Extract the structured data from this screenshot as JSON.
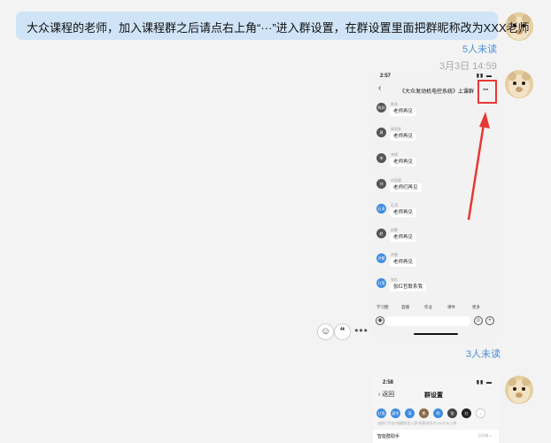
{
  "chat": {
    "message_text": "大众课程的老师，加入课程群之后请点右上角“···”进入群设置，在群设置里面把群昵称改为XXX老师",
    "message_read_status": "5人未读",
    "timestamp": "3月3日 14:59",
    "image_read_status": "3人未读"
  },
  "phone_screenshot": {
    "status_time": "2:57",
    "nav_title": "《大众发动机电控系统》上课群",
    "more_glyph": "···",
    "messages": [
      {
        "name": "陈润",
        "text": "老师再见",
        "avatar": "陈润"
      },
      {
        "name": "周润发",
        "text": "老师再见",
        "avatar": "周"
      },
      {
        "name": "李明",
        "text": "老师再见",
        "avatar": "李"
      },
      {
        "name": "刘思颖",
        "text": "老师们再见",
        "avatar": "刘"
      },
      {
        "name": "石涛",
        "text": "老师再见",
        "avatar": "石涛"
      },
      {
        "name": "赵鹏",
        "text": "老师再见",
        "avatar": "赵"
      },
      {
        "name": "洪慧",
        "text": "老师再见",
        "avatar": "洪慧"
      },
      {
        "name": "张红",
        "text": "张红哲联系我",
        "avatar": "红莲"
      }
    ],
    "toolbar": [
      "学习圈",
      "直播",
      "作业",
      "课件",
      "更多"
    ]
  },
  "settings_screenshot": {
    "status_time": "2:58",
    "back_label": "返回",
    "title": "群设置",
    "members": [
      "红莲",
      "颖华",
      "涛",
      "熊",
      "明",
      "张",
      "红",
      "+"
    ],
    "note": "该群已开启“隐藏群员入群”和群成员在120天未上线",
    "row_left": "智能群助手",
    "row_right": "已开启 >"
  },
  "icons": {
    "emoji": "emoji-icon",
    "quote": "quote-icon",
    "more": "more-icon"
  },
  "colors": {
    "bubble": "#cfe4f7",
    "link": "#4a90d9",
    "highlight": "#e53935"
  }
}
